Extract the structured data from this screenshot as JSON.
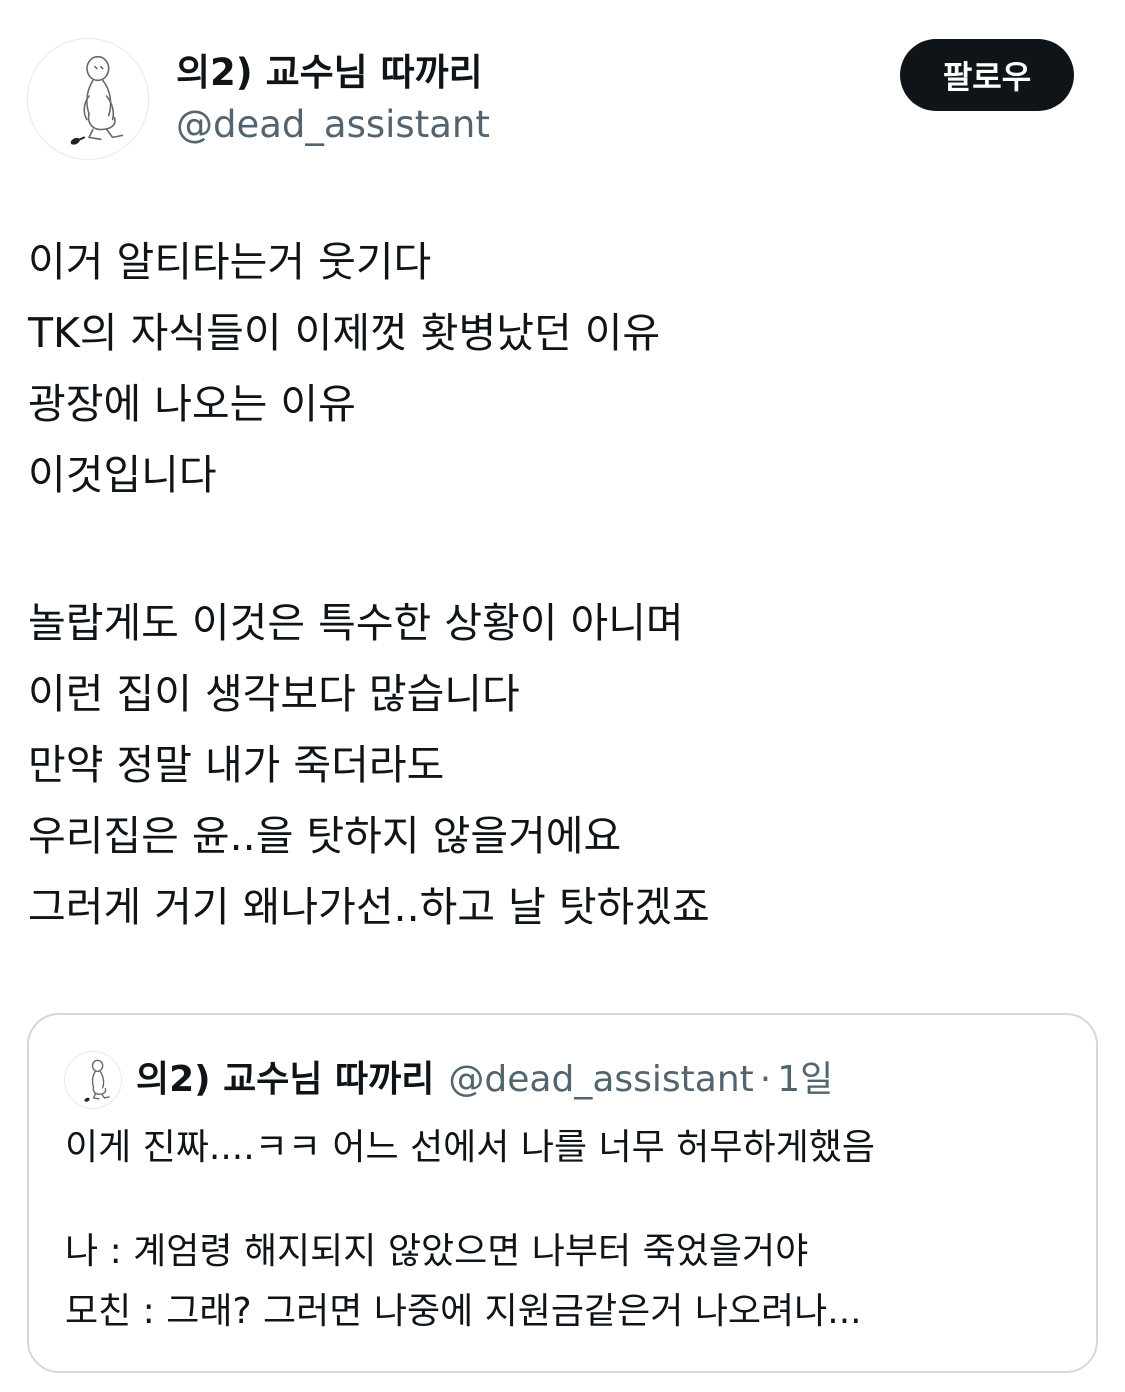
{
  "header": {
    "display_name": "의2) 교수님 따까리",
    "handle": "@dead_assistant",
    "follow_label": "팔로우",
    "avatar_icon": "person-kneeling-sketch-icon"
  },
  "tweet": {
    "lines": [
      "이거 알티타는거 웃기다",
      "TK의 자식들이 이제껏 홧병났던 이유",
      "광장에 나오는 이유",
      "이것입니다",
      "",
      "놀랍게도 이것은 특수한 상황이 아니며",
      "이런 집이 생각보다 많습니다",
      "만약 정말 내가 죽더라도",
      "우리집은 윤..을 탓하지 않을거에요",
      "그러게 거기 왜나가선..하고 날 탓하겠죠"
    ]
  },
  "quote": {
    "display_name": "의2) 교수님 따까리",
    "handle": "@dead_assistant",
    "separator": "·",
    "time": "1일",
    "lines": [
      "이게 진짜....ㅋㅋ 어느 선에서 나를 너무 허무하게했음",
      "",
      "나 : 계엄령 해지되지 않았으면 나부터 죽었을거야",
      "모친 : 그래? 그러면 나중에 지원금같은거 나오려나..."
    ]
  },
  "colors": {
    "text": "#0f1419",
    "secondary": "#536471",
    "border": "#cfd9de",
    "button_bg": "#0f1419",
    "button_text": "#ffffff"
  }
}
